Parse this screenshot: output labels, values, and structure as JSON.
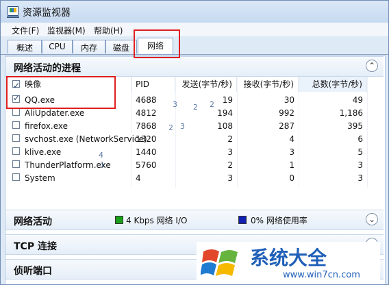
{
  "window": {
    "title": "资源监视器"
  },
  "menu": [
    "文件(F)",
    "监视器(M)",
    "帮助(H)"
  ],
  "tabs": [
    "概述",
    "CPU",
    "内存",
    "磁盘",
    "网络"
  ],
  "process_section": {
    "title": "网络活动的进程",
    "columns": [
      "映像",
      "PID",
      "发送(字节/秒)",
      "接收(字节/秒)",
      "总数(字节/秒)"
    ],
    "rows": [
      {
        "name": "QQ.exe",
        "pid": "4688",
        "send": "19",
        "recv": "30",
        "total": "49",
        "checked": true
      },
      {
        "name": "AliUpdater.exe",
        "pid": "4812",
        "send": "194",
        "recv": "992",
        "total": "1,186",
        "checked": false
      },
      {
        "name": "firefox.exe",
        "pid": "7868",
        "send": "108",
        "recv": "287",
        "total": "395",
        "checked": false
      },
      {
        "name": "svchost.exe (NetworkService)",
        "pid": "1320",
        "send": "2",
        "recv": "4",
        "total": "6",
        "checked": false
      },
      {
        "name": "klive.exe",
        "pid": "1440",
        "send": "3",
        "recv": "3",
        "total": "5",
        "checked": false
      },
      {
        "name": "ThunderPlatform.exe",
        "pid": "5760",
        "send": "2",
        "recv": "1",
        "total": "3",
        "checked": false
      },
      {
        "name": "System",
        "pid": "4",
        "send": "3",
        "recv": "0",
        "total": "3",
        "checked": false
      }
    ]
  },
  "network_section": {
    "title": "网络活动",
    "io_label": "4 Kbps 网络 I/O",
    "usage_label": "0% 网络使用率",
    "io_color": "#1aa01a",
    "usage_color": "#1020b0"
  },
  "tcp_section": {
    "title": "TCP 连接"
  },
  "listen_section": {
    "title": "侦听端口"
  },
  "overlay_numbers": [
    "3",
    "2",
    "2",
    "2",
    "3",
    "4",
    "1"
  ],
  "watermark": {
    "main": "系统大全",
    "url": "www.win7cn.com"
  }
}
